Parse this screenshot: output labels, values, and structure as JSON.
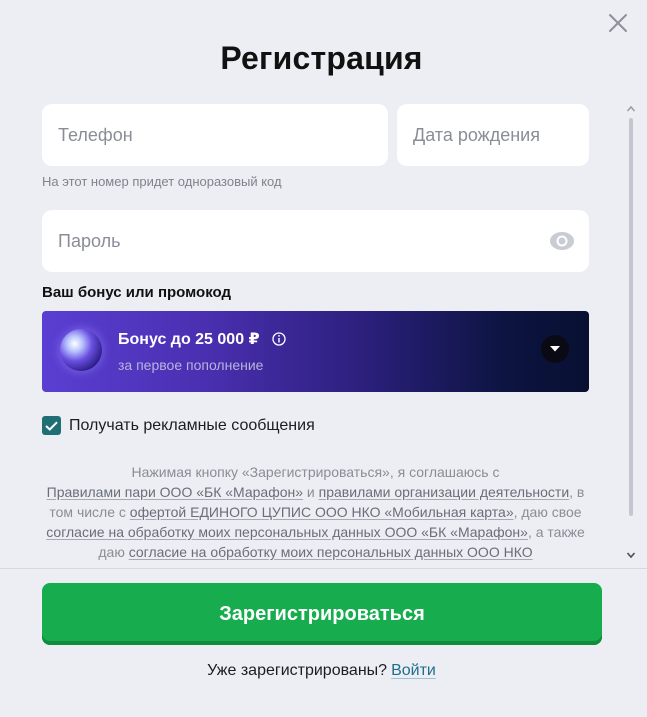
{
  "title": "Регистрация",
  "fields": {
    "phone_placeholder": "Телефон",
    "dob_placeholder": "Дата рождения",
    "phone_hint": "На этот номер придет одноразовый код",
    "password_placeholder": "Пароль"
  },
  "bonus": {
    "heading": "Ваш бонус или промокод",
    "title": "Бонус до 25 000 ₽",
    "subtitle": "за первое пополнение"
  },
  "checkbox": {
    "label": "Получать рекламные сообщения",
    "checked": true
  },
  "legal": {
    "t1": "Нажимая кнопку «Зарегистрироваться», я соглашаюсь с",
    "link1": "Правилами пари ООО «БК «Марафон»",
    "t2": " и ",
    "link2": "правилами организации деятельности",
    "t3": ", в том числе с ",
    "link3": "офертой ЕДИНОГО ЦУПИС ООО НКО «Мобильная карта»",
    "t4": ", даю свое ",
    "link4": "согласие на обработку моих персональных данных ООО «БК «Марафон»",
    "t5": ", а также даю ",
    "link5": "согласие на обработку моих персональных данных ООО НКО"
  },
  "submit_label": "Зарегистрироваться",
  "login": {
    "prompt": "Уже зарегистрированы?",
    "link": "Войти"
  },
  "colors": {
    "background": "#eceef3",
    "submit": "#17ad4e",
    "checkbox": "#1e6e74",
    "link": "#1e6e8c"
  },
  "icons": {
    "close": "close-icon",
    "eye": "eye-icon",
    "info": "info-icon",
    "chevron": "chevron-down-icon",
    "check": "check-icon"
  }
}
